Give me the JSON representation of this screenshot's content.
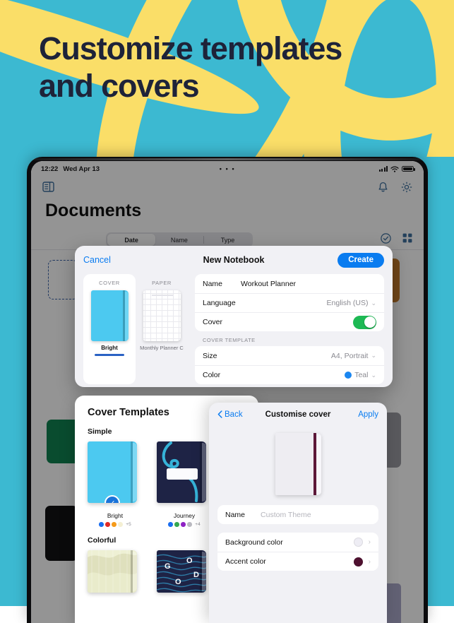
{
  "hero": {
    "title": "Customize templates\nand covers",
    "bg_color": "#3cb9d1",
    "ribbon_color": "#fade68",
    "title_color": "#1e2339"
  },
  "status_bar": {
    "time": "12:22",
    "date": "Wed Apr 13",
    "center_dots": "• • •"
  },
  "app": {
    "title": "Documents",
    "sidebar_icon": "sidebar-book-icon",
    "bell_icon": "bell-icon",
    "gear_icon": "gear-icon",
    "select_icon": "check-circle-icon",
    "grid_icon": "grid-view-icon",
    "sort_segments": [
      {
        "label": "Date",
        "selected": true
      },
      {
        "label": "Name",
        "selected": false
      },
      {
        "label": "Type",
        "selected": false
      }
    ],
    "background_cards": [
      {
        "name": "new-doc-placeholder",
        "color": "",
        "dashed": true
      },
      {
        "name": "green-notebook",
        "color": "#118352"
      },
      {
        "name": "black-notebook",
        "color": "#121214"
      },
      {
        "name": "orange-notebook",
        "color": "#c47a2b"
      },
      {
        "name": "grey-notebook",
        "color": "#9a9aa1"
      },
      {
        "name": "cream-cover",
        "color": "#e6e2c4"
      },
      {
        "name": "maroon-cover",
        "color": "#6d2330"
      },
      {
        "name": "paisley-cover",
        "color": "#a9a7c8"
      }
    ]
  },
  "new_notebook_modal": {
    "cancel_label": "Cancel",
    "title": "New Notebook",
    "create_label": "Create",
    "cover_tab": {
      "caption": "COVER",
      "name": "Bright",
      "color": "#4cc9f0",
      "selected": true
    },
    "paper_tab": {
      "caption": "PAPER",
      "name": "Monthly Planner C",
      "selected": false
    },
    "fields": [
      {
        "label": "Name",
        "value": "Workout Planner",
        "type": "text",
        "chevron": false
      },
      {
        "label": "Language",
        "value": "English (US)",
        "type": "select",
        "chevron": true
      },
      {
        "label": "Cover",
        "value": "on",
        "type": "toggle",
        "toggle_color": "#1db954"
      }
    ],
    "cover_template_caption": "COVER TEMPLATE",
    "cover_template_fields": [
      {
        "label": "Size",
        "value": "A4, Portrait",
        "type": "select",
        "chevron": true
      },
      {
        "label": "Color",
        "value": "Teal",
        "type": "color-select",
        "swatch": "#1a86f0",
        "chevron": true
      }
    ]
  },
  "cover_templates_panel": {
    "title": "Cover Templates",
    "sections": [
      {
        "name": "Simple",
        "items": [
          {
            "name": "Bright",
            "selected": true,
            "cover_color": "#4cc9f0",
            "style": "plain",
            "swatches": [
              "#1a6ef0",
              "#e02b28",
              "#f59b1a",
              "#f4efd3"
            ],
            "more": "+5"
          },
          {
            "name": "Journey",
            "selected": false,
            "cover_color": "#1e2345",
            "style": "journey",
            "swatches": [
              "#1a6ef0",
              "#36a852",
              "#8f23c4",
              "#b9b9c0"
            ],
            "more": "+4"
          }
        ]
      },
      {
        "name": "Colorful",
        "items": [
          {
            "name": "",
            "selected": false,
            "cover_color": "#dfe0bd",
            "style": "camo",
            "swatches": [],
            "more": ""
          },
          {
            "name": "",
            "selected": false,
            "cover_color": "#1e2345",
            "style": "good",
            "swatches": [],
            "more": ""
          }
        ]
      }
    ]
  },
  "customise_cover_panel": {
    "back_label": "Back",
    "back_icon": "chevron-left-icon",
    "title": "Customise cover",
    "apply_label": "Apply",
    "preview": {
      "background_color": "#eeedf2",
      "accent_color": "#5c1738"
    },
    "name_row": {
      "label": "Name",
      "placeholder": "Custom Theme",
      "value": ""
    },
    "color_rows": [
      {
        "label": "Background color",
        "swatch": "#eeedf4"
      },
      {
        "label": "Accent color",
        "swatch": "#4f1130"
      }
    ]
  }
}
